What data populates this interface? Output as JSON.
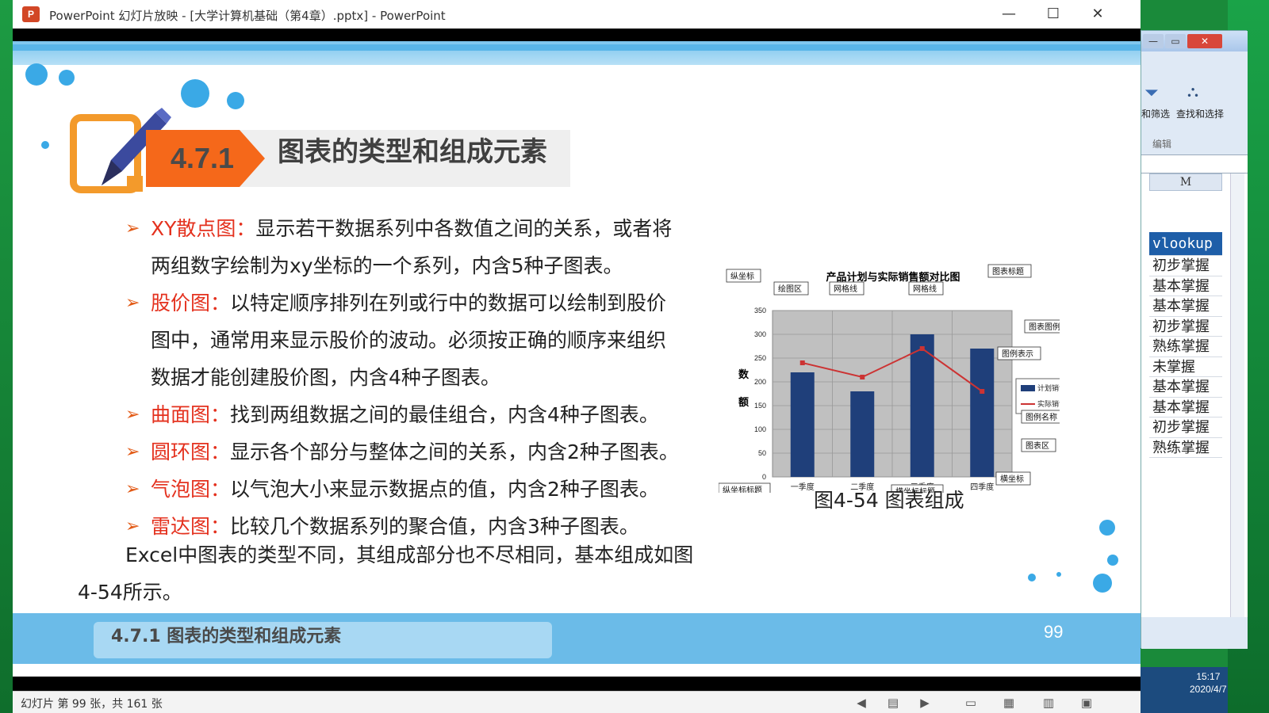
{
  "window": {
    "title": "PowerPoint 幻灯片放映 - [大学计算机基础（第4章）.pptx] - PowerPoint",
    "minimize": "—",
    "maximize": "☐",
    "close": "✕",
    "app_icon": "P"
  },
  "slide": {
    "section_number": "4.7.1",
    "section_title": "图表的类型和组成元素",
    "bullets": [
      {
        "term": "XY散点图：",
        "text": "显示若干数据系列中各数值之间的关系，或者将",
        "cont": "两组数字绘制为xy坐标的一个系列，内含5种子图表。"
      },
      {
        "term": "股价图：",
        "text": "以特定顺序排列在列或行中的数据可以绘制到股价",
        "cont": "图中，通常用来显示股价的波动。必须按正确的顺序来组织",
        "cont2": "数据才能创建股价图，内含4种子图表。"
      },
      {
        "term": "曲面图：",
        "text": "找到两组数据之间的最佳组合，内含4种子图表。"
      },
      {
        "term": "圆环图：",
        "text": "显示各个部分与整体之间的关系，内含2种子图表。"
      },
      {
        "term": "气泡图：",
        "text": "以气泡大小来显示数据点的值，内含2种子图表。"
      },
      {
        "term": "雷达图：",
        "text": "比较几个数据系列的聚合值，内含3种子图表。"
      }
    ],
    "paragraph": "Excel中图表的类型不同，其组成部分也不尽相同，基本组成如图4-54所示。",
    "figure_caption": "图4-54  图表组成",
    "footer_label": "4.7.1  图表的类型和组成元素",
    "page_number": "99"
  },
  "chart_data": {
    "type": "bar",
    "title": "产品计划与实际销售额对比图",
    "categories": [
      "一季度",
      "二季度",
      "三季度",
      "四季度"
    ],
    "series": [
      {
        "name": "计划销售额",
        "values": [
          220,
          180,
          300,
          270
        ],
        "color": "#1f3f7a"
      },
      {
        "name": "实际销售额",
        "values": [
          240,
          210,
          270,
          180
        ],
        "color": "#cc3333"
      }
    ],
    "yticks": [
      0,
      50,
      100,
      150,
      200,
      250,
      300,
      350
    ],
    "ylim": [
      0,
      350
    ],
    "xlabel": "季  度",
    "ylabel": "数额",
    "grid": true,
    "legend": "right",
    "annotations": [
      "纵坐标",
      "绘图区",
      "网格线",
      "网格线",
      "图表标题",
      "图表图例",
      "图例表示",
      "图例名称",
      "图表区",
      "纵坐标标题",
      "横坐标标题",
      "横坐标"
    ]
  },
  "statusbar": {
    "slide_info": "幻灯片 第 99 张，共 161 张"
  },
  "excel": {
    "ribbon_filter": "和筛选",
    "ribbon_find": "查找和选择",
    "ribbon_group": "编辑",
    "column": "M",
    "cells": [
      "vlookup",
      "初步掌握",
      "基本掌握",
      "基本掌握",
      "初步掌握",
      "熟练掌握",
      "未掌握",
      "基本掌握",
      "基本掌握",
      "初步掌握",
      "熟练掌握"
    ]
  },
  "clock": {
    "time": "15:17",
    "date": "2020/4/7"
  }
}
